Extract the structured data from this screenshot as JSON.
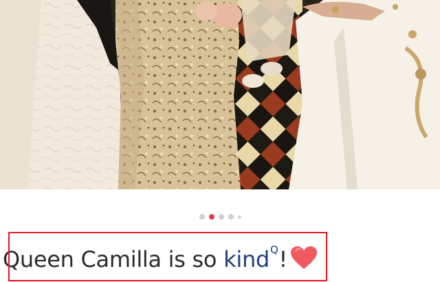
{
  "photo": {
    "alt_icon": "photo-image"
  },
  "carousel": {
    "total": 5,
    "active_index": 1,
    "colors": {
      "active": "#e23b4a",
      "inactive": "#cfcfcf"
    }
  },
  "post": {
    "caption_main": "Queen Camilla is so",
    "caption_keyword": "kind",
    "caption_sup": "Q",
    "caption_tail": "!",
    "emoji": "heart-emoji"
  },
  "highlight": {
    "color": "#e8141c"
  }
}
